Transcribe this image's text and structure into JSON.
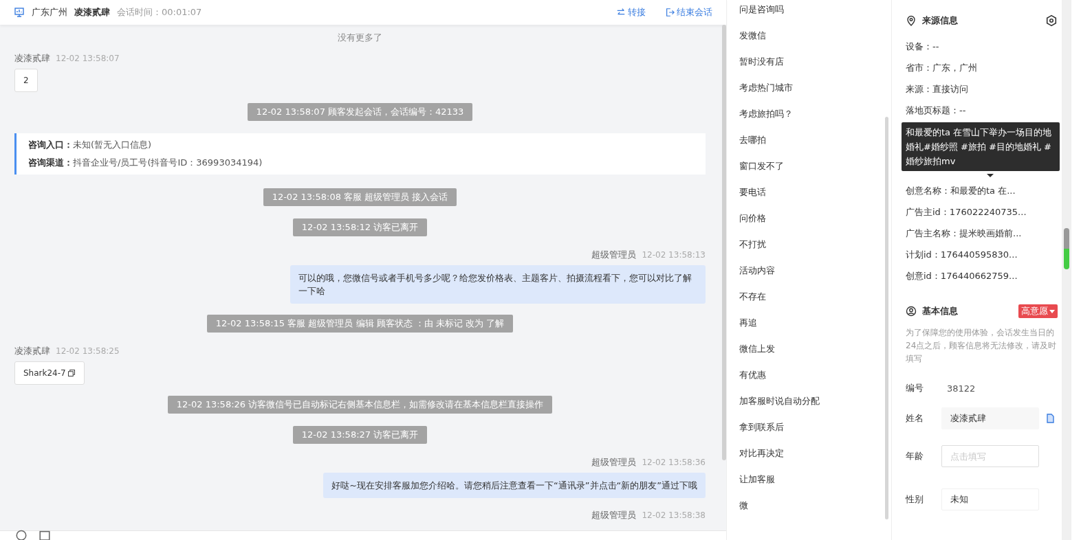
{
  "header": {
    "location": "广东广州",
    "visitor": "凌漆贰肆",
    "duration": "会话时间：00:01:07",
    "actions": [
      {
        "kind": "transfer",
        "label": "转接"
      },
      {
        "kind": "end",
        "label": "结束会话"
      }
    ]
  },
  "chat": {
    "no_more": "没有更多了",
    "messages": [
      {
        "kind": "visitor",
        "name": "凌漆贰肆",
        "time": "12-02 13:58:07",
        "text": "2",
        "copyable": false
      },
      {
        "kind": "system",
        "text": "12-02 13:58:07 顾客发起会话，会话编号：42133"
      },
      {
        "kind": "info",
        "lines": [
          "**咨询入口：**未知(暂无入口信息)",
          "**咨询渠道：**抖音企业号/员工号(抖音号ID：36993034194)"
        ]
      },
      {
        "kind": "system",
        "text": "12-02 13:58:08 客服 超级管理员 接入会话"
      },
      {
        "kind": "system",
        "text": "12-02 13:58:12 访客已离开"
      },
      {
        "kind": "agent",
        "name": "超级管理员",
        "time": "12-02 13:58:13",
        "text": "可以的哦，您微信号或者手机号多少呢？给您发价格表、主题客片、拍摄流程看下，您可以对比了解一下哈"
      },
      {
        "kind": "system",
        "text": "12-02 13:58:15 客服 超级管理员 编辑 顾客状态 ：由 未标记 改为 了解"
      },
      {
        "kind": "visitor",
        "name": "凌漆贰肆",
        "time": "12-02 13:58:25",
        "text": "Shark24-7",
        "copyable": true
      },
      {
        "kind": "system",
        "text": "12-02 13:58:26 访客微信号已自动标记右侧基本信息栏，如需修改请在基本信息栏直接操作"
      },
      {
        "kind": "system",
        "text": "12-02 13:58:27 访客已离开"
      },
      {
        "kind": "agent",
        "name": "超级管理员",
        "time": "12-02 13:58:36",
        "text": "好哒~现在安排客服加您介绍哈。请您稍后注意查看一下“通讯录”并点击“新的朋友”通过下哦"
      },
      {
        "kind": "agent",
        "name": "超级管理员",
        "time": "12-02 13:58:38"
      }
    ]
  },
  "quick_replies": [
    "问是咨询吗",
    "发微信",
    "暂时没有店",
    "考虑热门城市",
    "考虑旅拍吗？",
    "去哪拍",
    "窗口发不了",
    "要电话",
    "问价格",
    "不打扰",
    "活动内容",
    "不存在",
    "再追",
    "微信上发",
    "有优惠",
    "加客服时说自动分配",
    "拿到联系后",
    "对比再决定",
    "让加客服",
    "微"
  ],
  "source_info": {
    "title": "来源信息",
    "rows": [
      "设备：--",
      "省市：广东，广州",
      "来源：直接访问",
      "落地页标题：--"
    ],
    "tooltip": "和最爱的ta 在雪山下举办一场目的地婚礼#婚纱照 #旅拍 #目的地婚礼 #婚纱旅拍mv",
    "rows_after": [
      "创意名称：和最爱的ta 在...",
      "广告主id：176022240735...",
      "广告主名称：提米映画婚前...",
      "计划id：176440595830...",
      "创意id：176440662759..."
    ]
  },
  "basic_info": {
    "title": "基本信息",
    "intent_tag": "高意愿",
    "note": "为了保障您的使用体验，会话发生当日的24点之后，顾客信息将无法修改，请及时填写",
    "fields": [
      {
        "kind": "text",
        "label": "编号",
        "value": "38122"
      },
      {
        "kind": "filled",
        "label": "姓名",
        "value": "凌漆贰肆"
      },
      {
        "kind": "input",
        "label": "年龄",
        "placeholder": "点击填写"
      },
      {
        "kind": "select",
        "label": "性别",
        "value": "未知"
      }
    ]
  }
}
